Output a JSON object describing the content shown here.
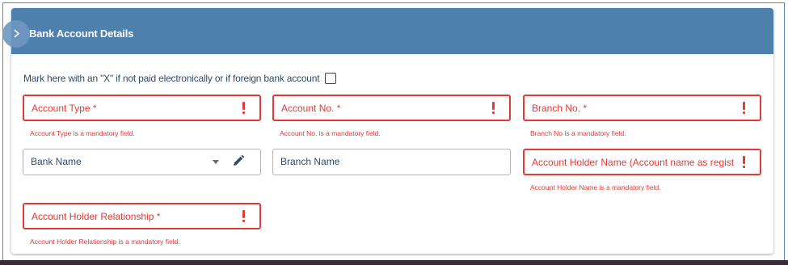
{
  "section": {
    "title": "Bank Account Details"
  },
  "checkbox": {
    "label": "Mark here with an \"X\" if not paid electronically or if foreign bank account",
    "checked": false
  },
  "fields": {
    "account_type": {
      "label": "Account Type *",
      "error": "Account Type is a mandatory field."
    },
    "account_no": {
      "label": "Account No. *",
      "error": "Account No. is a mandatory field."
    },
    "branch_no": {
      "label": "Branch No. *",
      "error": "Branch No is a mandatory field."
    },
    "bank_name": {
      "label": "Bank Name"
    },
    "branch_name": {
      "label": "Branch Name"
    },
    "account_holder_name": {
      "label": "Account Holder Name (Account name as registere...",
      "error": "Account Holder Name is a mandatory field."
    },
    "account_holder_relationship": {
      "label": "Account Holder Relationship *",
      "error": "Account Holder Relationship is a mandatory field."
    }
  },
  "icons": {
    "toggle": "chevron-right-icon",
    "error": "exclamation-icon",
    "dropdown": "caret-down-icon",
    "edit": "pencil-icon"
  },
  "colors": {
    "header_bg": "#4e80ad",
    "error": "#e53935",
    "label_text": "#2f4b6b"
  }
}
